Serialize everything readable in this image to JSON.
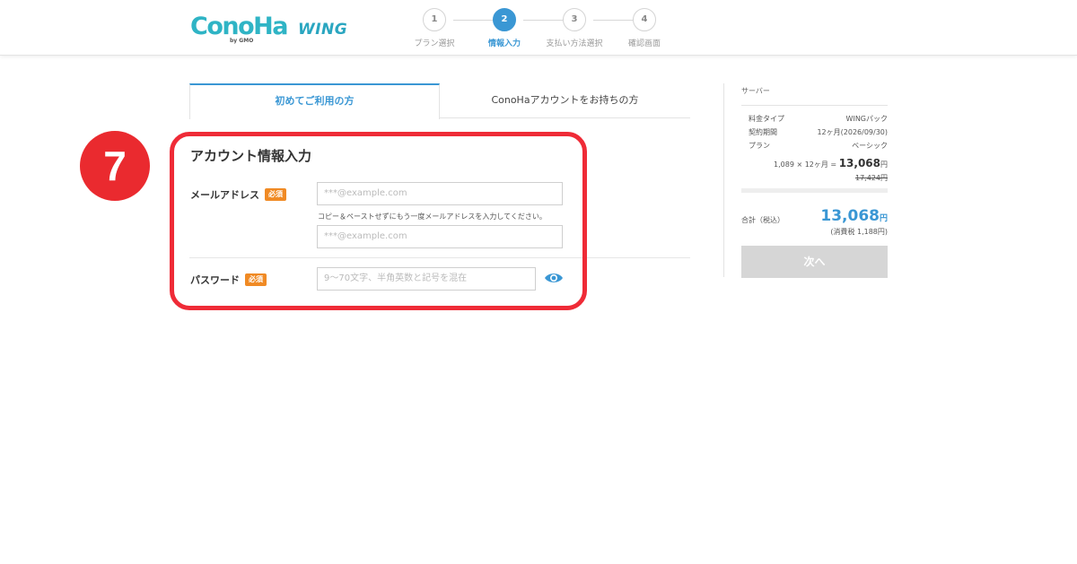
{
  "header": {
    "logo_main": "ConoHa",
    "logo_sub": "by GMO",
    "logo_wing": "WING",
    "steps": [
      {
        "number": "1",
        "label": "プラン選択"
      },
      {
        "number": "2",
        "label": "情報入力"
      },
      {
        "number": "3",
        "label": "支払い方法選択"
      },
      {
        "number": "4",
        "label": "確認画面"
      }
    ],
    "active_step": 2
  },
  "tabs": [
    {
      "label": "初めてご利用の方",
      "active": true
    },
    {
      "label": "ConoHaアカウントをお持ちの方",
      "active": false
    }
  ],
  "form": {
    "section_title": "アカウント情報入力",
    "email_label": "メールアドレス",
    "required_badge": "必須",
    "email_placeholder": "***@example.com",
    "email_hint": "コピー＆ペーストせずにもう一度メールアドレスを入力してください。",
    "email_confirm_placeholder": "***@example.com",
    "password_label": "パスワード",
    "password_placeholder": "9～70文字、半角英数と記号を混在"
  },
  "annotation": {
    "badge_number": "7",
    "highlight_color": "#ef2b37"
  },
  "summary": {
    "heading": "サーバー",
    "rows": [
      {
        "label": "料金タイプ",
        "value": "WINGパック"
      },
      {
        "label": "契約期間",
        "value": "12ヶ月(2026/09/30)"
      },
      {
        "label": "プラン",
        "value": "ベーシック"
      }
    ],
    "calc_prefix": "1,089 × 12ヶ月 = ",
    "calc_amount": "13,068",
    "calc_unit": "円",
    "original_price": "17,424円",
    "total_label": "合計（税込）",
    "total_amount": "13,068",
    "total_unit": "円",
    "tax_note": "(消費税 1,188円)",
    "next_button": "次へ"
  },
  "colors": {
    "accent": "#3a97d4",
    "required": "#f08a24",
    "logo": "#2fb4c5",
    "button_disabled": "#d6d6d6"
  }
}
